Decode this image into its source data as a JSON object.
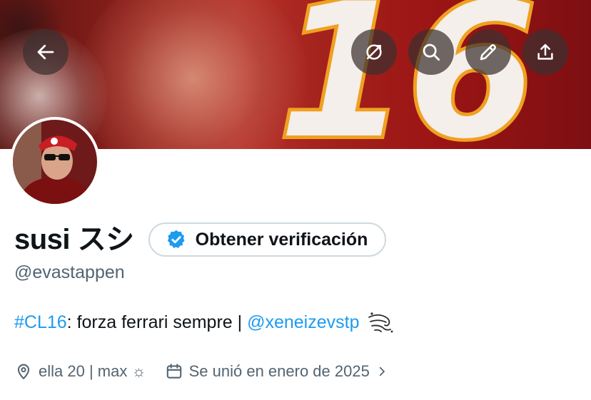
{
  "banner": {
    "number": "16"
  },
  "header_controls": {
    "back": {
      "icon": "back-arrow-icon"
    },
    "buttons": [
      {
        "icon": "translate-icon"
      },
      {
        "icon": "search-icon"
      },
      {
        "icon": "edit-icon"
      },
      {
        "icon": "share-icon"
      }
    ]
  },
  "profile": {
    "display_name": "susi スシ",
    "verify_button": {
      "label": "Obtener verificación",
      "icon": "verified-badge-icon",
      "color": "#1d9bf0"
    },
    "handle": "@evastappen",
    "bio": {
      "hashtag": "#CL16",
      "text": ": forza ferrari sempre | ",
      "mention": "@xeneizevstp",
      "emoji": "wind-gust-icon"
    },
    "meta": {
      "location": {
        "icon": "location-pin-icon",
        "text": "ella 20 | max ☼"
      },
      "joined": {
        "icon": "calendar-icon",
        "text": "Se unió en enero de 2025",
        "chevron": "chevron-right-icon"
      }
    }
  },
  "colors": {
    "accent": "#1d9bf0",
    "text": "#0f1419",
    "secondary_text": "#536471",
    "border": "#cfd9de"
  }
}
